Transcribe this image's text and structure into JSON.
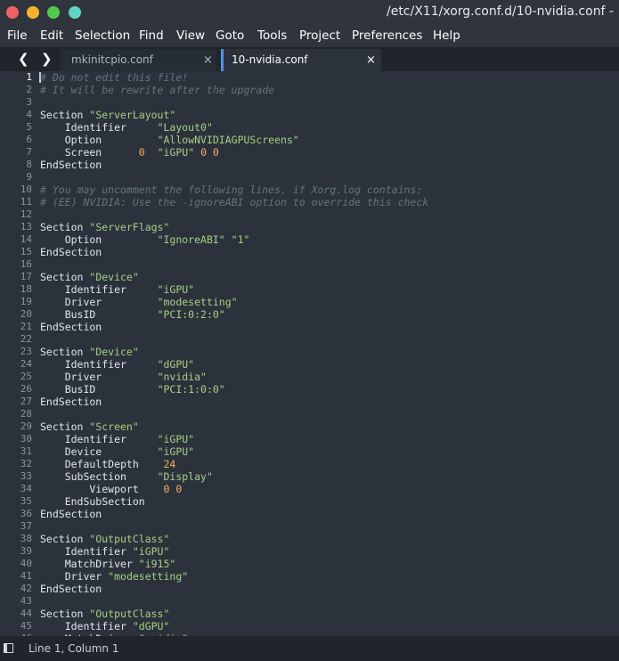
{
  "window": {
    "title": "/etc/X11/xorg.conf.d/10-nvidia.conf -",
    "controls": [
      {
        "name": "close",
        "color": "#f46067"
      },
      {
        "name": "minimize",
        "color": "#f5b32f"
      },
      {
        "name": "maximize",
        "color": "#54c84d"
      },
      {
        "name": "fullscreen",
        "color": "#61d4c1"
      }
    ]
  },
  "menu": [
    "File",
    "Edit",
    "Selection",
    "Find",
    "View",
    "Goto",
    "Tools",
    "Project",
    "Preferences",
    "Help"
  ],
  "tabs": [
    {
      "label": "mkinitcpio.conf",
      "close": "×",
      "active": false
    },
    {
      "label": "10-nvidia.conf",
      "close": "×",
      "active": true
    }
  ],
  "nav": {
    "back": "❮",
    "forward": "❯"
  },
  "editor": {
    "active_line": 1,
    "lines": [
      [
        [
          "c",
          "# Do not edit this file!"
        ]
      ],
      [
        [
          "c",
          "# It will be rewrite after the upgrade"
        ]
      ],
      [],
      [
        [
          "p",
          "Section "
        ],
        [
          "s",
          "\"ServerLayout\""
        ]
      ],
      [
        [
          "p",
          "    Identifier     "
        ],
        [
          "s",
          "\"Layout0\""
        ]
      ],
      [
        [
          "p",
          "    Option         "
        ],
        [
          "s",
          "\"AllowNVIDIAGPUScreens\""
        ]
      ],
      [
        [
          "p",
          "    Screen      "
        ],
        [
          "n",
          "0"
        ],
        [
          "p",
          "  "
        ],
        [
          "s",
          "\"iGPU\""
        ],
        [
          "p",
          " "
        ],
        [
          "n",
          "0 0"
        ]
      ],
      [
        [
          "p",
          "EndSection"
        ]
      ],
      [],
      [
        [
          "c",
          "# You may uncomment the following lines, if Xorg.log contains:"
        ]
      ],
      [
        [
          "c",
          "# (EE) NVIDIA: Use the -ignoreABI option to override this check"
        ]
      ],
      [],
      [
        [
          "p",
          "Section "
        ],
        [
          "s",
          "\"ServerFlags\""
        ]
      ],
      [
        [
          "p",
          "    Option         "
        ],
        [
          "s",
          "\"IgnoreABI\" \"1\""
        ]
      ],
      [
        [
          "p",
          "EndSection"
        ]
      ],
      [],
      [
        [
          "p",
          "Section "
        ],
        [
          "s",
          "\"Device\""
        ]
      ],
      [
        [
          "p",
          "    Identifier     "
        ],
        [
          "s",
          "\"iGPU\""
        ]
      ],
      [
        [
          "p",
          "    Driver         "
        ],
        [
          "s",
          "\"modesetting\""
        ]
      ],
      [
        [
          "p",
          "    BusID          "
        ],
        [
          "s",
          "\"PCI:0:2:0\""
        ]
      ],
      [
        [
          "p",
          "EndSection"
        ]
      ],
      [],
      [
        [
          "p",
          "Section "
        ],
        [
          "s",
          "\"Device\""
        ]
      ],
      [
        [
          "p",
          "    Identifier     "
        ],
        [
          "s",
          "\"dGPU\""
        ]
      ],
      [
        [
          "p",
          "    Driver         "
        ],
        [
          "s",
          "\"nvidia\""
        ]
      ],
      [
        [
          "p",
          "    BusID          "
        ],
        [
          "s",
          "\"PCI:1:0:0\""
        ]
      ],
      [
        [
          "p",
          "EndSection"
        ]
      ],
      [],
      [
        [
          "p",
          "Section "
        ],
        [
          "s",
          "\"Screen\""
        ]
      ],
      [
        [
          "p",
          "    Identifier     "
        ],
        [
          "s",
          "\"iGPU\""
        ]
      ],
      [
        [
          "p",
          "    Device         "
        ],
        [
          "s",
          "\"iGPU\""
        ]
      ],
      [
        [
          "p",
          "    DefaultDepth    "
        ],
        [
          "n",
          "24"
        ]
      ],
      [
        [
          "p",
          "    SubSection     "
        ],
        [
          "s",
          "\"Display\""
        ]
      ],
      [
        [
          "p",
          "        Viewport    "
        ],
        [
          "n",
          "0 0"
        ]
      ],
      [
        [
          "p",
          "    EndSubSection"
        ]
      ],
      [
        [
          "p",
          "EndSection"
        ]
      ],
      [],
      [
        [
          "p",
          "Section "
        ],
        [
          "s",
          "\"OutputClass\""
        ]
      ],
      [
        [
          "p",
          "    Identifier "
        ],
        [
          "s",
          "\"iGPU\""
        ]
      ],
      [
        [
          "p",
          "    MatchDriver "
        ],
        [
          "s",
          "\"i915\""
        ]
      ],
      [
        [
          "p",
          "    Driver "
        ],
        [
          "s",
          "\"modesetting\""
        ]
      ],
      [
        [
          "p",
          "EndSection"
        ]
      ],
      [],
      [
        [
          "p",
          "Section "
        ],
        [
          "s",
          "\"OutputClass\""
        ]
      ],
      [
        [
          "p",
          "    Identifier "
        ],
        [
          "s",
          "\"dGPU\""
        ]
      ],
      [
        [
          "p",
          "    MatchDriver "
        ],
        [
          "s",
          "\"nvidia\""
        ]
      ]
    ]
  },
  "statusbar": {
    "position": "Line 1, Column 1"
  },
  "colors": {
    "accent": "#5294e2",
    "comment": "#65737e",
    "string": "#a6d082",
    "number": "#f9ae58"
  }
}
